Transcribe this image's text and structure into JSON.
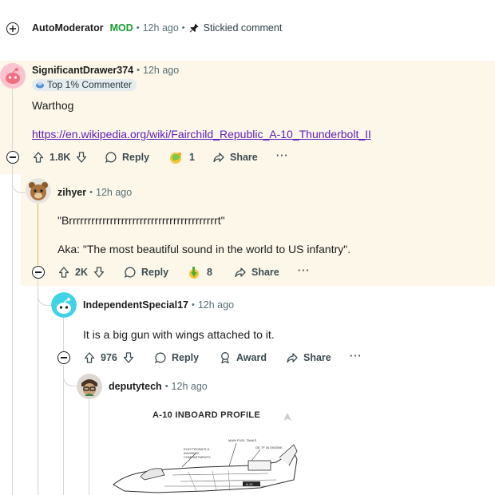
{
  "automod": {
    "username": "AutoModerator",
    "mod_tag": "MOD",
    "time": "12h ago",
    "stickied": "Stickied comment"
  },
  "comments": [
    {
      "username": "SignificantDrawer374",
      "time": "12h ago",
      "flair": "Top 1% Commenter",
      "body_lines": [
        "Warthog"
      ],
      "link": "https://en.wikipedia.org/wiki/Fairchild_Republic_A-10_Thunderbolt_II",
      "score": "1.8K",
      "reply": "Reply",
      "award_count": "1",
      "share": "Share",
      "more": "···"
    },
    {
      "username": "zihyer",
      "time": "12h ago",
      "body_lines": [
        "\"Brrrrrrrrrrrrrrrrrrrrrrrrrrrrrrrrrrrrrrrrt\"",
        "Aka: \"The most beautiful sound in the world to US infantry\"."
      ],
      "score": "2K",
      "reply": "Reply",
      "award_count": "8",
      "share": "Share",
      "more": "···"
    },
    {
      "username": "IndependentSpecial17",
      "time": "12h ago",
      "body_lines": [
        "It is a big gun with wings attached to it."
      ],
      "score": "976",
      "reply": "Reply",
      "award": "Award",
      "share": "Share",
      "more": "···"
    },
    {
      "username": "deputytech",
      "time": "12h ago",
      "image": {
        "title": "A-10 INBOARD PROFILE",
        "labels": [
          "ELECTRONICS & AVIONICS COMPARTMENTS",
          "MAIN FUEL TANKS",
          "GE TF 34 ENGINE"
        ]
      }
    }
  ],
  "colors": {
    "highlight": "#fdf7e9",
    "link": "#5d21b8",
    "mod": "#1a9e31",
    "meta": "#576f76"
  }
}
